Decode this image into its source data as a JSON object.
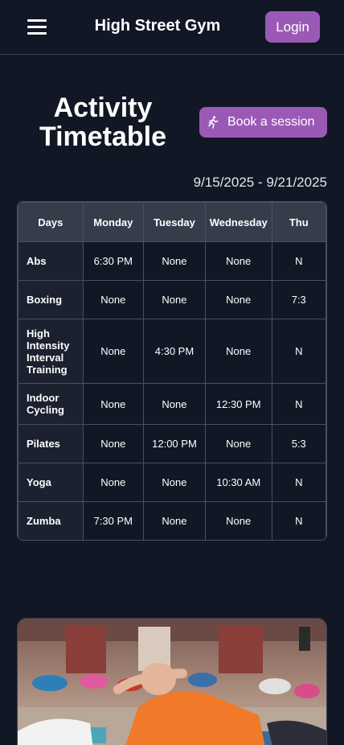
{
  "navbar": {
    "brand": "High Street Gym",
    "login_label": "Login"
  },
  "page": {
    "title": "Activity Timetable",
    "book_label": "Book a session",
    "date_range": "9/15/2025 - 9/21/2025"
  },
  "timetable": {
    "headers": [
      "Days",
      "Monday",
      "Tuesday",
      "Wednesday",
      "Thu"
    ],
    "rows": [
      {
        "activity": "Abs",
        "cells": [
          "6:30 PM",
          "None",
          "None",
          "N"
        ]
      },
      {
        "activity": "Boxing",
        "cells": [
          "None",
          "None",
          "None",
          "7:3"
        ]
      },
      {
        "activity": "High Intensity Interval Training",
        "cells": [
          "None",
          "4:30 PM",
          "None",
          "N"
        ]
      },
      {
        "activity": "Indoor Cycling",
        "cells": [
          "None",
          "None",
          "12:30 PM",
          "N"
        ]
      },
      {
        "activity": "Pilates",
        "cells": [
          "None",
          "12:00 PM",
          "None",
          "5:3"
        ]
      },
      {
        "activity": "Yoga",
        "cells": [
          "None",
          "None",
          "10:30 AM",
          "N"
        ]
      },
      {
        "activity": "Zumba",
        "cells": [
          "7:30 PM",
          "None",
          "None",
          "N"
        ]
      }
    ]
  },
  "icons": {
    "menu": "hamburger-menu-icon",
    "book": "running-person-icon"
  },
  "colors": {
    "background": "#121725",
    "accent": "#9b59b6",
    "table_header": "#353d4b"
  }
}
